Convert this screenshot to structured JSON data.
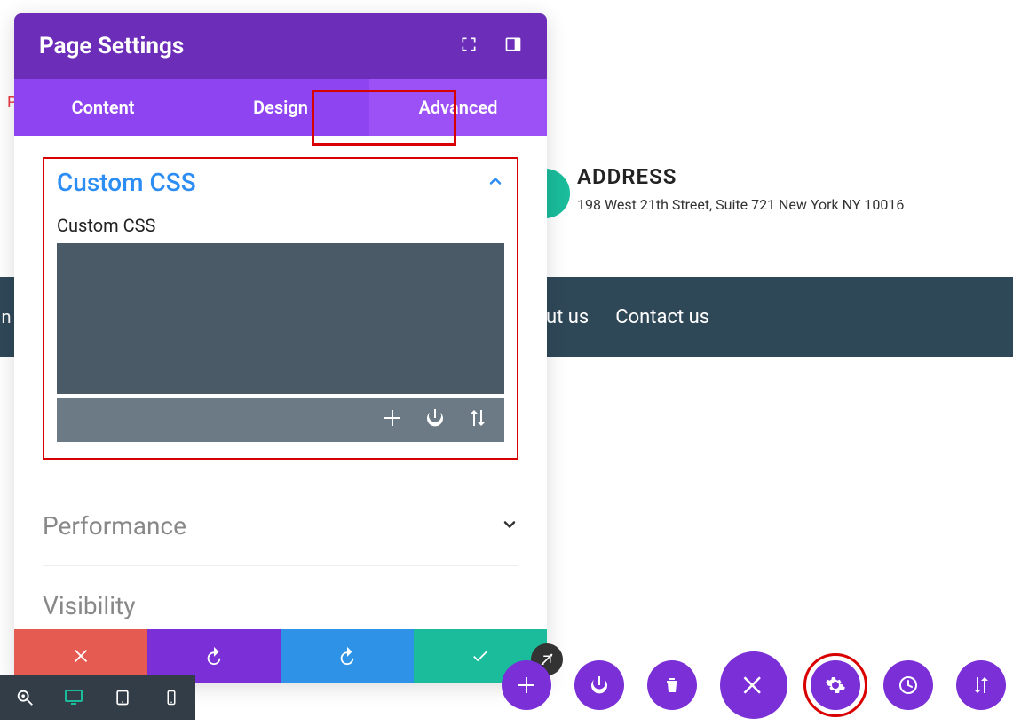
{
  "panel": {
    "title": "Page Settings",
    "tabs": [
      "Content",
      "Design",
      "Advanced"
    ],
    "active_tab": 2,
    "sections": {
      "custom_css": {
        "title": "Custom CSS",
        "label": "Custom CSS",
        "value": ""
      },
      "performance": {
        "title": "Performance"
      },
      "visibility": {
        "title": "Visibility"
      }
    }
  },
  "bg": {
    "red_fragment": "P",
    "address_title": "ADDRESS",
    "address_text": "198 West 21th Street, Suite 721 New York NY 10016",
    "nav_items": [
      "ut us",
      "Contact us"
    ],
    "nav_edge": "n"
  }
}
